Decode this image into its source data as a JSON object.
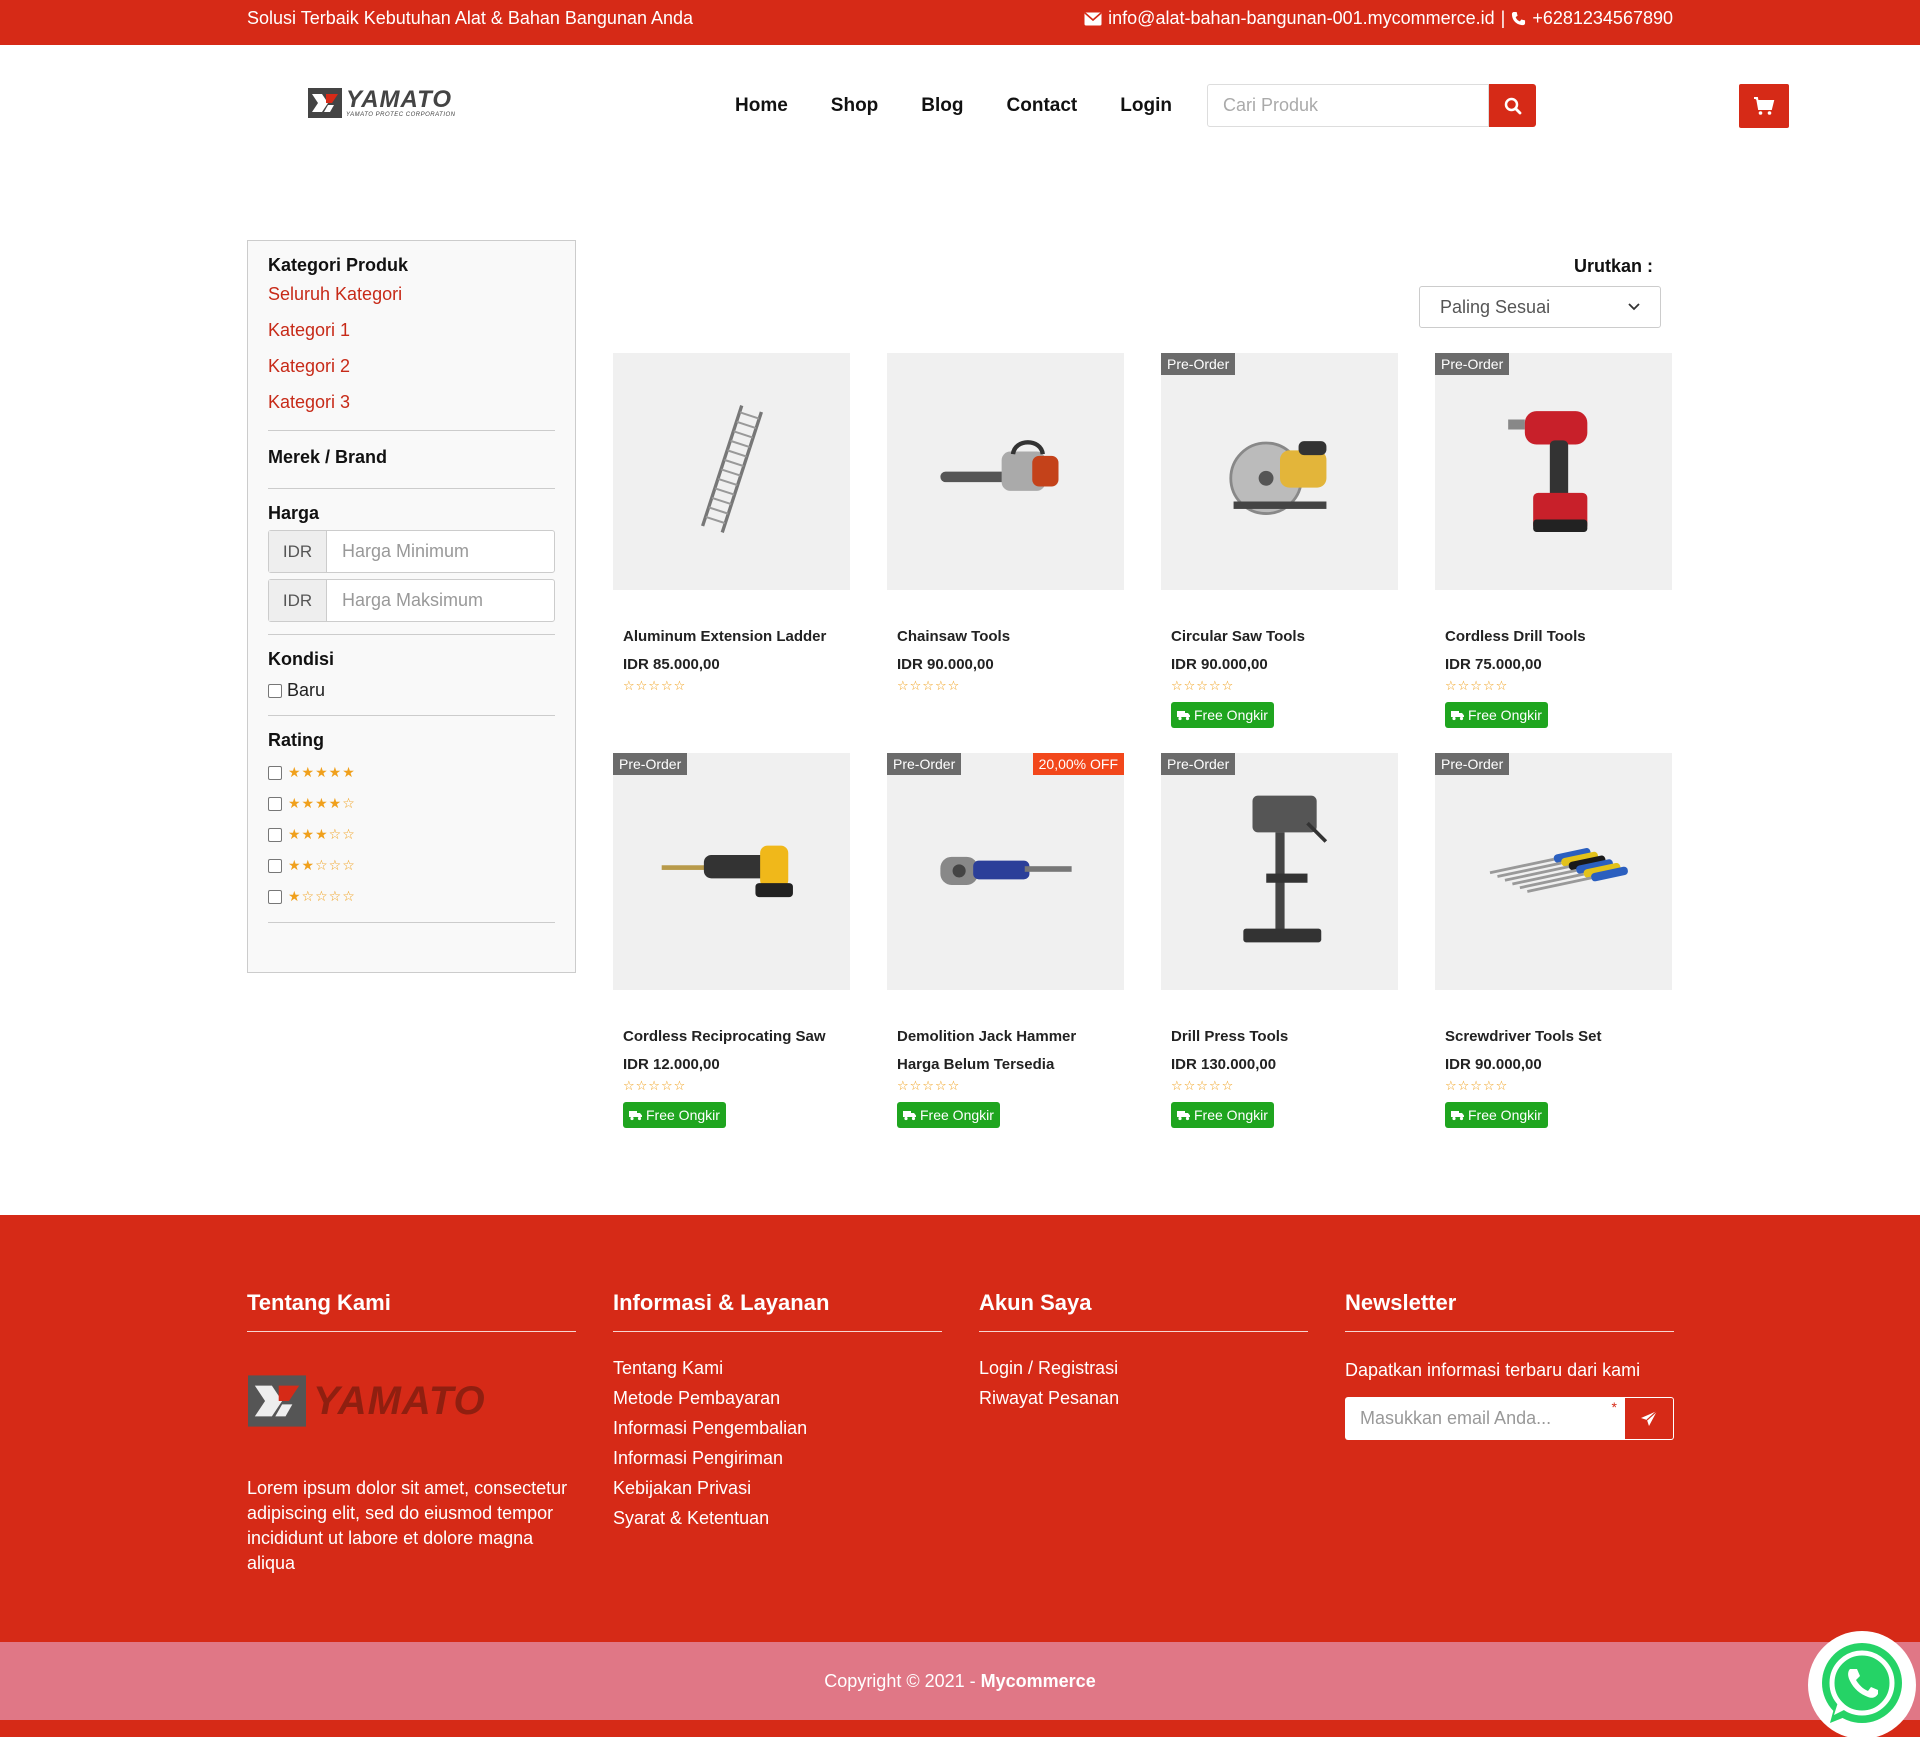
{
  "topbar": {
    "tagline": "Solusi Terbaik Kebutuhan Alat & Bahan Bangunan Anda",
    "email": "info@alat-bahan-bangunan-001.mycommerce.id",
    "separator": "|",
    "phone": "+6281234567890"
  },
  "brand": {
    "name": "YAMATO",
    "subtitle": "YAMATO PROTEC CORPORATION"
  },
  "nav": {
    "items": [
      "Home",
      "Shop",
      "Blog",
      "Contact",
      "Login"
    ]
  },
  "search": {
    "placeholder": "Cari Produk"
  },
  "sidebar": {
    "category_title": "Kategori Produk",
    "categories": [
      "Seluruh Kategori",
      "Kategori 1",
      "Kategori 2",
      "Kategori 3"
    ],
    "brand_title": "Merek / Brand",
    "price_title": "Harga",
    "currency": "IDR",
    "min_placeholder": "Harga Minimum",
    "max_placeholder": "Harga Maksimum",
    "condition_title": "Kondisi",
    "condition_option": "Baru",
    "rating_title": "Rating",
    "rating_options": [
      5,
      4,
      3,
      2,
      1
    ]
  },
  "sort": {
    "label": "Urutkan :",
    "selected": "Paling Sesuai"
  },
  "badges": {
    "preorder": "Pre-Order",
    "free_shipping": "Free Ongkir"
  },
  "products": [
    {
      "name": "Aluminum Extension Ladder",
      "price": "IDR 85.000,00",
      "rating": 0,
      "preorder": false,
      "discount": "",
      "free_shipping": false,
      "icon": "ladder-icon"
    },
    {
      "name": "Chainsaw Tools",
      "price": "IDR 90.000,00",
      "rating": 0,
      "preorder": false,
      "discount": "",
      "free_shipping": false,
      "icon": "chainsaw-icon"
    },
    {
      "name": "Circular Saw Tools",
      "price": "IDR 90.000,00",
      "rating": 0,
      "preorder": true,
      "discount": "",
      "free_shipping": true,
      "icon": "circular-saw-icon"
    },
    {
      "name": "Cordless Drill Tools",
      "price": "IDR 75.000,00",
      "rating": 0,
      "preorder": true,
      "discount": "",
      "free_shipping": true,
      "icon": "drill-icon"
    },
    {
      "name": "Cordless Reciprocating Saw",
      "price": "IDR 12.000,00",
      "rating": 0,
      "preorder": true,
      "discount": "",
      "free_shipping": true,
      "icon": "reciprocating-saw-icon"
    },
    {
      "name": "Demolition Jack Hammer",
      "price": "Harga Belum Tersedia",
      "rating": 0,
      "preorder": true,
      "discount": "20,00% OFF",
      "free_shipping": true,
      "icon": "jack-hammer-icon"
    },
    {
      "name": "Drill Press Tools",
      "price": "IDR 130.000,00",
      "rating": 0,
      "preorder": true,
      "discount": "",
      "free_shipping": true,
      "icon": "drill-press-icon"
    },
    {
      "name": "Screwdriver Tools Set",
      "price": "IDR 90.000,00",
      "rating": 0,
      "preorder": true,
      "discount": "",
      "free_shipping": true,
      "icon": "screwdriver-set-icon"
    }
  ],
  "footer": {
    "about_title": "Tentang Kami",
    "about_text": "Lorem ipsum dolor sit amet, consectetur adipiscing elit, sed do eiusmod tempor incididunt ut labore et dolore magna aliqua",
    "info_title": "Informasi & Layanan",
    "info_links": [
      "Tentang Kami",
      "Metode Pembayaran",
      "Informasi Pengembalian",
      "Informasi Pengiriman",
      "Kebijakan Privasi",
      "Syarat & Ketentuan"
    ],
    "account_title": "Akun Saya",
    "account_links": [
      "Login / Registrasi",
      "Riwayat Pesanan"
    ],
    "newsletter_title": "Newsletter",
    "newsletter_text": "Dapatkan informasi terbaru dari kami",
    "newsletter_placeholder": "Masukkan email Anda...",
    "required_mark": "*"
  },
  "copyright": {
    "text": "Copyright © 2021 - ",
    "brand": "Mycommerce"
  },
  "colors": {
    "primary": "#d62a17",
    "copy_bar": "#e07786",
    "free_shipping": "#1fa51f",
    "discount": "#f2471b",
    "star": "#f0a01c"
  }
}
